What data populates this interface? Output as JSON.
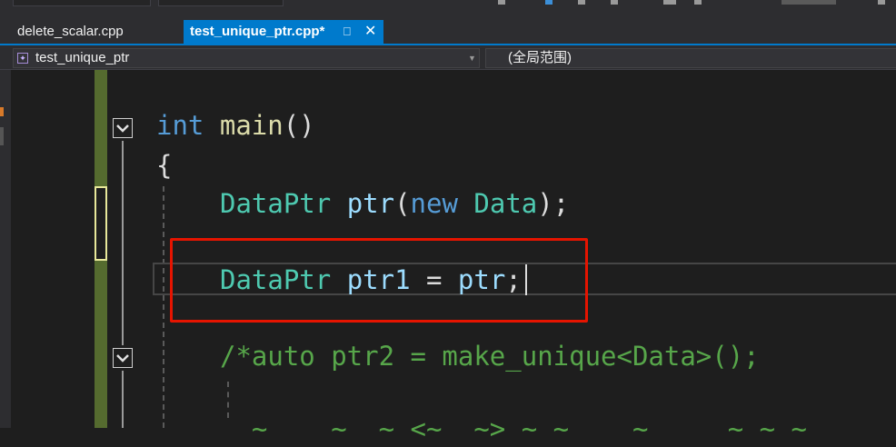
{
  "tabs": [
    {
      "label": "delete_scalar.cpp",
      "active": false
    },
    {
      "label": "test_unique_ptr.cpp*",
      "active": true,
      "pin_icon": "pin-icon",
      "close_icon": "close-icon"
    }
  ],
  "navbar": {
    "scope_left": "test_unique_ptr",
    "scope_right": "(全局范围)"
  },
  "code": {
    "line1": {
      "kw": "int",
      "fn": "main",
      "rest": "()"
    },
    "line2": "{",
    "line3": {
      "type": "DataPtr",
      "var": "ptr",
      "p1": "(",
      "kw": "new",
      "type2": "Data",
      "p2": ");"
    },
    "line4": {
      "type": "DataPtr",
      "var": "ptr1",
      "op": " = ",
      "var2": "ptr",
      "end": ";"
    },
    "line5": "/*auto ptr2 = make_unique<Data>();",
    "line6": "  ~    ~  ~ <~  ~> ~ ~    ~     ~ ~ ~"
  },
  "colors": {
    "accent": "#007acc",
    "highlight_box": "#e51400",
    "keyword": "#569cd6",
    "type": "#4ec9b0",
    "function": "#dcdcaa",
    "variable": "#9cdcfe",
    "comment": "#57a64a"
  }
}
